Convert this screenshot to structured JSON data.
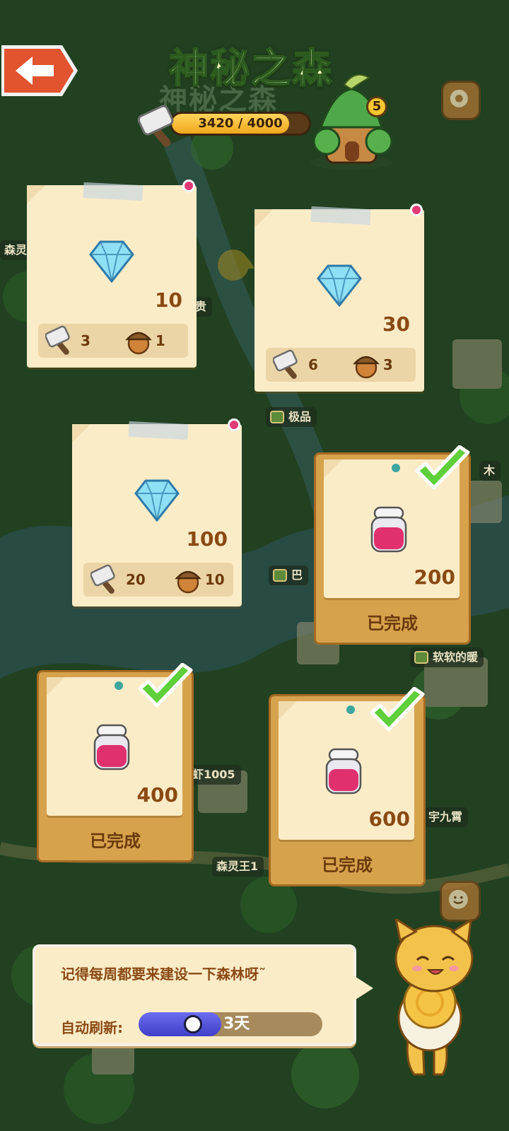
{
  "header": {
    "title": "神秘之森",
    "progress_text": "3420 / 4000",
    "progress_value": 3420,
    "progress_max": 4000,
    "level": "5"
  },
  "map_labels": [
    "森灵王",
    "贵",
    "极品",
    "巴",
    "软软的暖",
    "木",
    "虾1005",
    "森灵王1",
    "宇九霄"
  ],
  "cards": [
    {
      "reward": "diamond",
      "amount": "10",
      "hammer_cost": "3",
      "acorn_cost": "1",
      "completed": false
    },
    {
      "reward": "diamond",
      "amount": "30",
      "hammer_cost": "6",
      "acorn_cost": "3",
      "completed": false
    },
    {
      "reward": "diamond",
      "amount": "100",
      "hammer_cost": "20",
      "acorn_cost": "10",
      "completed": false
    },
    {
      "reward": "jar",
      "amount": "200",
      "status": "已完成",
      "completed": true
    },
    {
      "reward": "jar",
      "amount": "400",
      "status": "已完成",
      "completed": true
    },
    {
      "reward": "jar",
      "amount": "600",
      "status": "已完成",
      "completed": true
    }
  ],
  "tip": {
    "message": "记得每周都要来建设一下森林呀˜",
    "refresh_label": "自动刷新:",
    "refresh_value": "3天",
    "refresh_fraction": 0.45
  },
  "colors": {
    "title_fill": "#e6f5b8",
    "progress_fill": "#f0a81e",
    "pin": "#e23a76",
    "check": "#5fcf3a",
    "amount_text": "#8a4a14"
  }
}
